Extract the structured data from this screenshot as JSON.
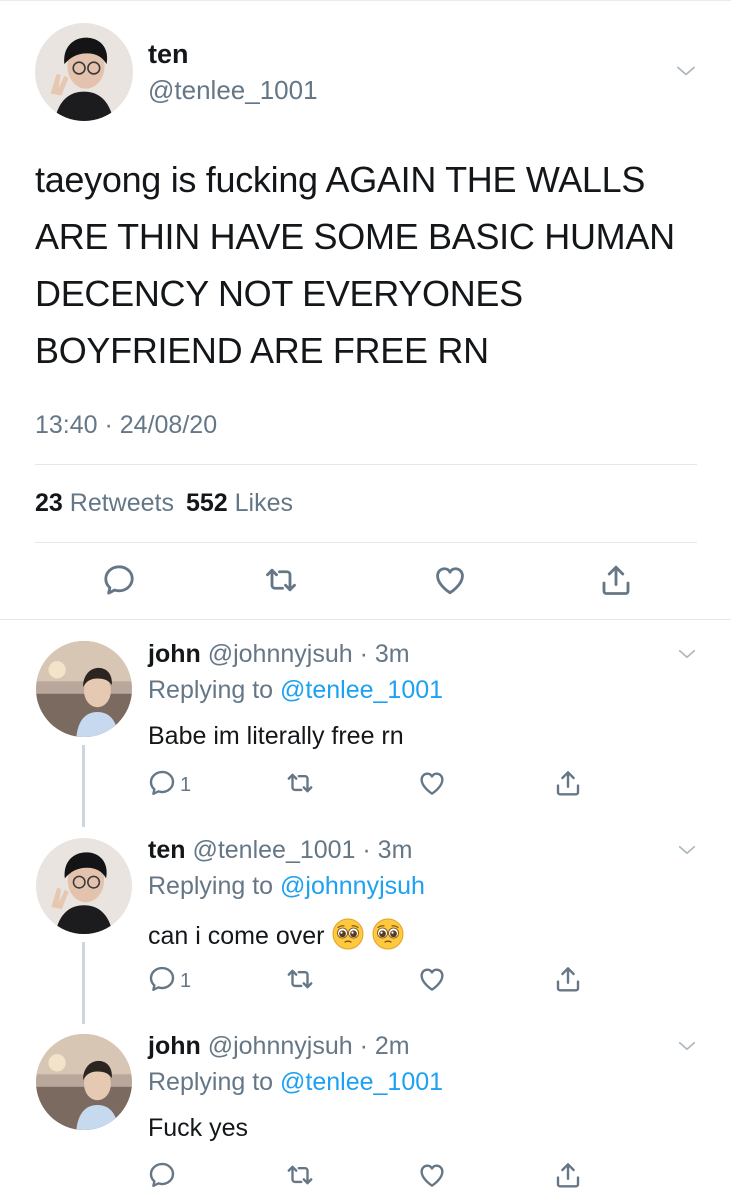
{
  "main_tweet": {
    "author_name": "ten",
    "author_handle": "@tenlee_1001",
    "text": "taeyong is fucking AGAIN THE WALLS ARE THIN HAVE SOME BASIC HUMAN DECENCY NOT EVERYONES BOYFRIEND ARE FREE RN",
    "timestamp": "13:40 · 24/08/20",
    "retweet_count": "23",
    "retweet_label": "Retweets",
    "like_count": "552",
    "like_label": "Likes"
  },
  "replies": [
    {
      "author_name": "john",
      "meta": "@johnnyjsuh · 3m",
      "replying_prefix": "Replying to",
      "replying_to": "@tenlee_1001",
      "text": "Babe im literally free rn",
      "reply_count": "1"
    },
    {
      "author_name": "ten",
      "meta": "@tenlee_1001 · 3m",
      "replying_prefix": "Replying to",
      "replying_to": "@johnnyjsuh",
      "text": "can i come over",
      "emojis": [
        "pleading-face-icon",
        "pleading-face-icon"
      ],
      "reply_count": "1"
    },
    {
      "author_name": "john",
      "meta": "@johnnyjsuh · 2m",
      "replying_prefix": "Replying to",
      "replying_to": "@tenlee_1001",
      "text": "Fuck yes",
      "reply_count": ""
    }
  ],
  "icons": {
    "reply": "reply-icon",
    "retweet": "retweet-icon",
    "like": "heart-icon",
    "share": "share-icon",
    "more": "chevron-down-icon"
  },
  "colors": {
    "link": "#1da1f2",
    "secondary_text": "#657786",
    "primary_text": "#14171a",
    "divider": "#e1e8ed"
  }
}
